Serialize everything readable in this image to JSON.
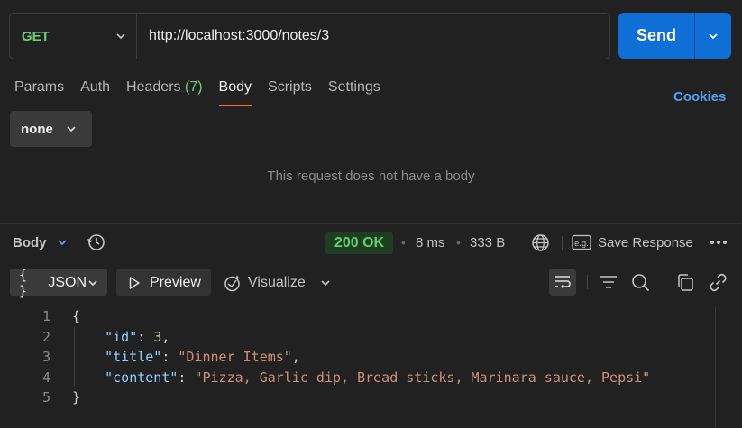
{
  "request": {
    "method": "GET",
    "url": "http://localhost:3000/notes/3",
    "send_label": "Send"
  },
  "tabs": [
    {
      "label": "Params"
    },
    {
      "label": "Auth"
    },
    {
      "label": "Headers",
      "count": "(7)"
    },
    {
      "label": "Body"
    },
    {
      "label": "Scripts"
    },
    {
      "label": "Settings"
    }
  ],
  "active_tab": "Body",
  "cookies_label": "Cookies",
  "body_type": "none",
  "no_body_message": "This request does not have a body",
  "response": {
    "section_label": "Body",
    "status": "200 OK",
    "time": "8 ms",
    "size": "333 B",
    "save_label": "Save Response",
    "format_label": "JSON",
    "preview_label": "Preview",
    "visualize_label": "Visualize",
    "code_lines": [
      {
        "n": "1",
        "text": "{"
      },
      {
        "n": "2",
        "key": "\"id\"",
        "sep": ": ",
        "value": "3",
        "tail": ",",
        "type": "num"
      },
      {
        "n": "3",
        "key": "\"title\"",
        "sep": ": ",
        "value": "\"Dinner Items\"",
        "tail": ",",
        "type": "str"
      },
      {
        "n": "4",
        "key": "\"content\"",
        "sep": ": ",
        "value": "\"Pizza, Garlic dip, Bread sticks, Marinara sauce, Pepsi\"",
        "tail": "",
        "type": "str"
      },
      {
        "n": "5",
        "text": "}"
      }
    ]
  },
  "icons": {
    "method_dropdown": "chevron-down-icon",
    "send_dropdown": "chevron-down-icon",
    "history": "history-icon",
    "globe": "globe-icon",
    "save": "example-icon",
    "more": "more-icon",
    "preview": "play-icon",
    "visualize": "visualize-icon",
    "wrap": "wrap-lines-icon",
    "filter": "filter-icon",
    "search": "search-icon",
    "copy": "copy-icon",
    "link": "link-icon"
  },
  "colors": {
    "accent": "#ff6c37",
    "send": "#0f6fd7",
    "method_get": "#6fcf75",
    "status_ok": "#62d16b",
    "link": "#4ea1f5"
  }
}
